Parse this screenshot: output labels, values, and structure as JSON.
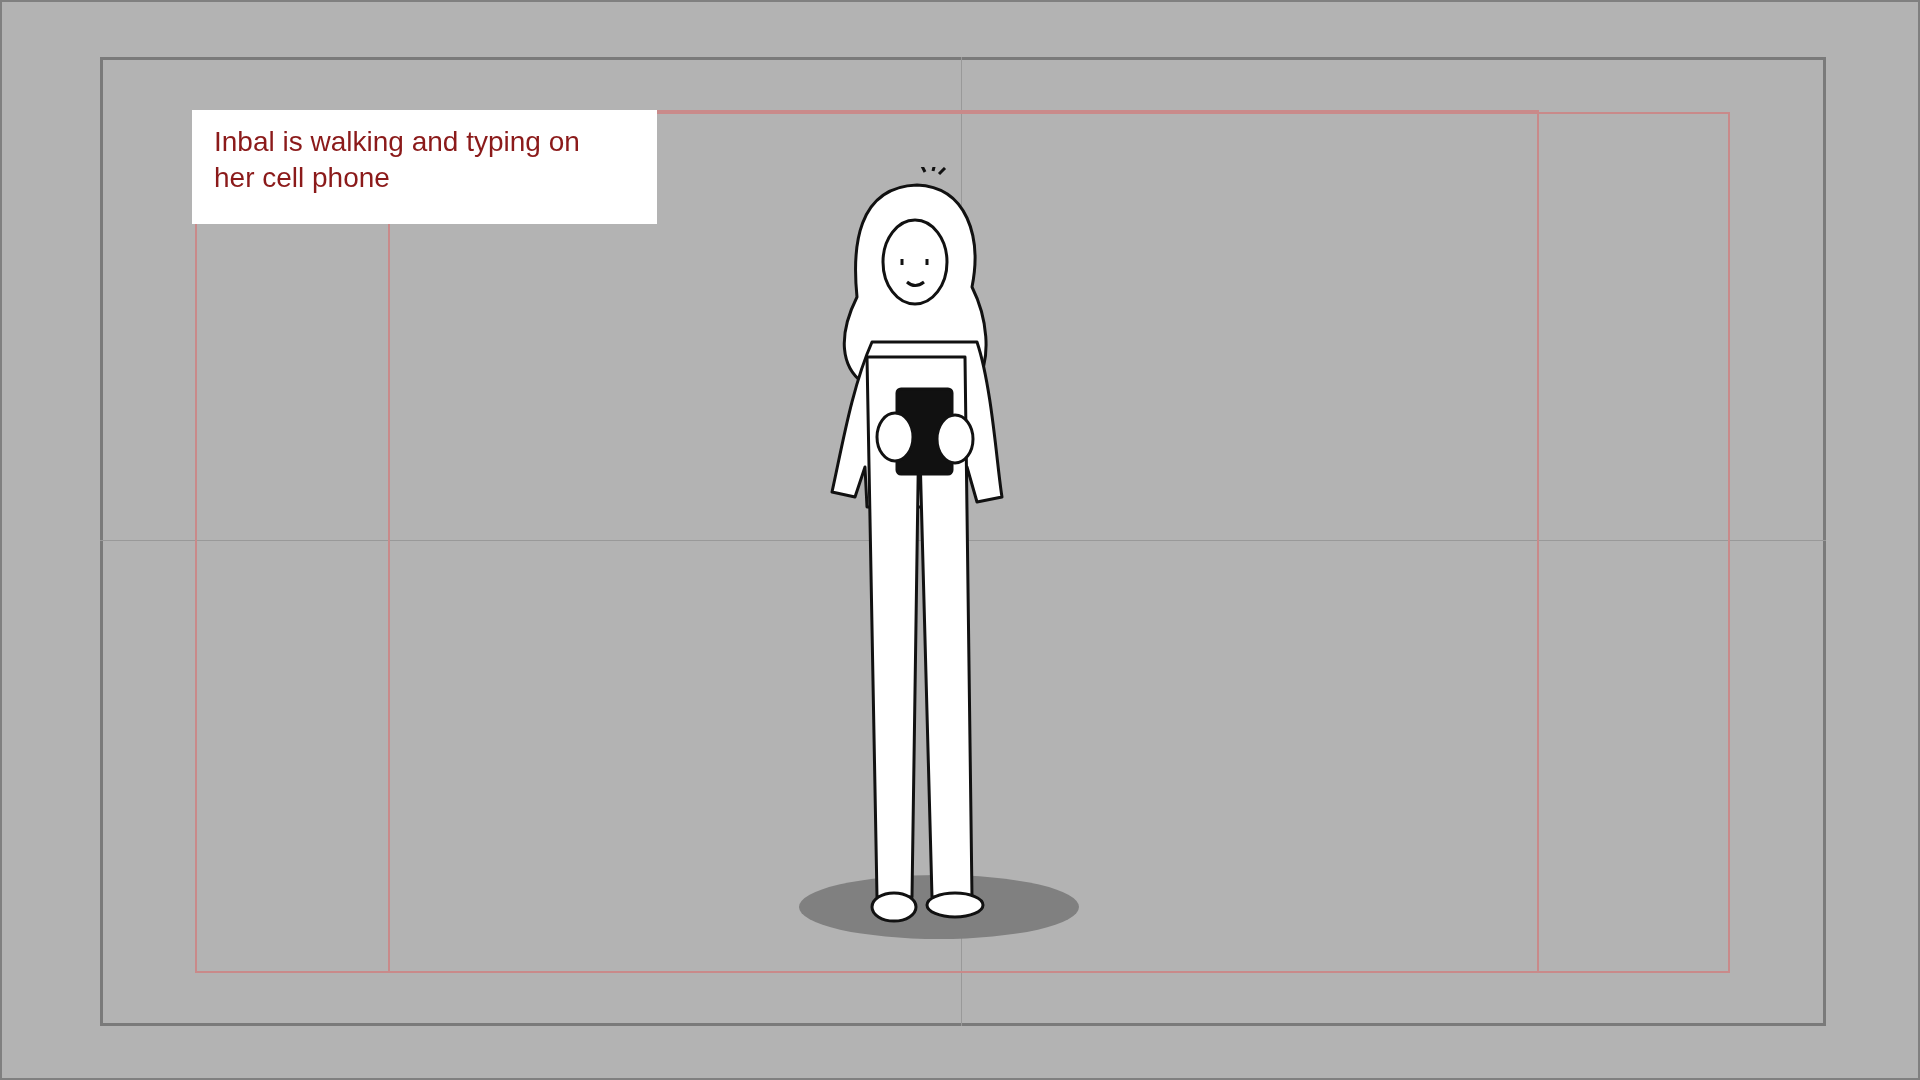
{
  "caption": "Inbal is walking and typing on her cell phone"
}
